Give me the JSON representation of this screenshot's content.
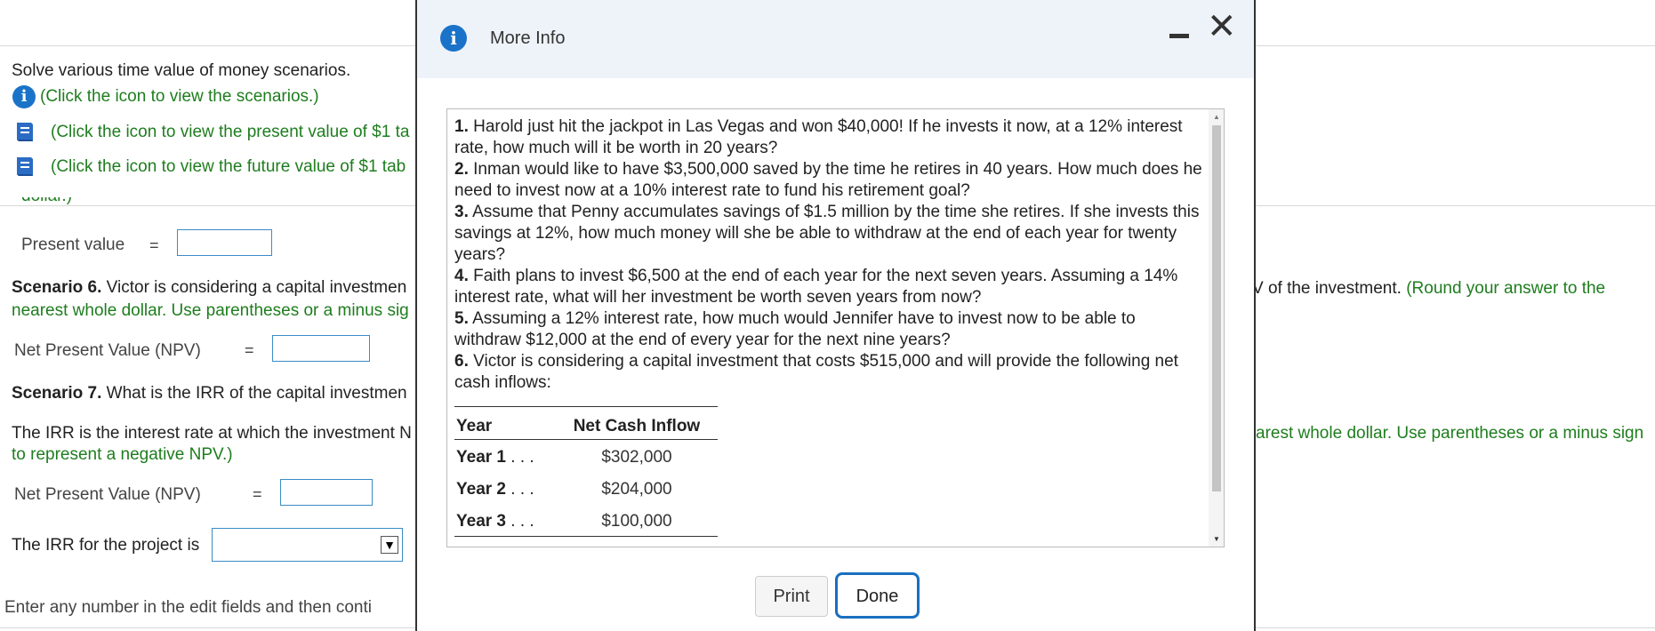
{
  "background": {
    "intro": "Solve various time value of money scenarios.",
    "scenarios_link": "(Click the icon to view the scenarios.)",
    "pv_table_link": "(Click the icon to view the present value of $1 ta",
    "fv_table_link": "(Click the icon to view the future value of $1 tab",
    "cut_text": "dollar.)",
    "present_value_label": "Present value",
    "equals": "=",
    "scenario6_bold": "Scenario 6.",
    "scenario6_text": " Victor is considering a capital investmen",
    "scenario6_green_start": "nearest whole dollar. Use parentheses or a minus sig",
    "scenario6_right_black": "V of the investment.",
    "scenario6_right_green": " (Round your answer to the",
    "npv_label": "Net Present Value (NPV)",
    "scenario7_bold": "Scenario 7.",
    "scenario7_text": " What is the IRR of the capital investmen",
    "irr_text": "The IRR is the interest rate at which the investment N",
    "irr_green": "to represent a negative NPV.)",
    "irr_right_green": "arest whole dollar. Use parentheses or a minus sign",
    "npv_label_2": "Net Present Value (NPV)",
    "irr_project_label": "The IRR for the project is",
    "footer_text": "Enter any number in the edit fields and then conti"
  },
  "modal": {
    "title": "More Info",
    "scenarios": [
      {
        "num": "1.",
        "text": " Harold just hit the jackpot in Las Vegas and won $40,000! If he invests it now, at a 12% interest rate, how much will it be worth in 20 years?"
      },
      {
        "num": "2.",
        "text": " Inman would like to have $3,500,000 saved by the time he retires in 40 years. How much does he need to invest now at a 10% interest rate to fund his retirement goal?"
      },
      {
        "num": "3.",
        "text": " Assume that Penny accumulates savings of $1.5 million by the time she retires. If she invests this savings at 12%, how much money will she be able to withdraw at the end of each year for twenty years?"
      },
      {
        "num": "4.",
        "text": " Faith plans to invest $6,500 at the end of each year for the next seven years. Assuming a 14% interest rate, what will her investment be worth seven years from now?"
      },
      {
        "num": "5.",
        "text": " Assuming a 12% interest rate, how much would Jennifer have to invest now to be able to withdraw $12,000 at the end of every year for the next nine years?"
      },
      {
        "num": "6.",
        "text": " Victor is considering a capital investment that costs $515,000 and will provide the following net cash inflows:"
      }
    ],
    "table": {
      "headers": [
        "Year",
        "Net Cash Inflow"
      ],
      "rows": [
        {
          "year": "Year 1",
          "dots": ". . .",
          "value": "$302,000"
        },
        {
          "year": "Year 2",
          "dots": ". . .",
          "value": "$204,000"
        },
        {
          "year": "Year 3",
          "dots": ". . .",
          "value": "$100,000"
        }
      ]
    },
    "print_label": "Print",
    "done_label": "Done"
  },
  "colors": {
    "link_green": "#1e7d1e",
    "info_blue": "#1a73c8",
    "input_border": "#3a8cc5",
    "header_bg": "#eef3fa"
  },
  "icons": [
    "info-icon",
    "book-icon",
    "minimize-icon",
    "close-icon",
    "dropdown-arrow-icon"
  ]
}
